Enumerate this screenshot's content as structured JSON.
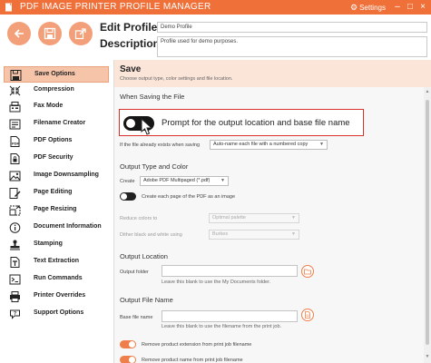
{
  "titlebar": {
    "title": "PDF IMAGE PRINTER PROFILE MANAGER",
    "settings_label": "Settings",
    "minimize": "–",
    "maximize": "□",
    "close": "×"
  },
  "header": {
    "title_line1": "Edit Profile -",
    "title_line2": "Description",
    "profile_name": "Demo Profile",
    "profile_description": "Profile used for demo purposes."
  },
  "sidebar": {
    "items": [
      {
        "label": "Save Options",
        "icon": "save-icon",
        "active": true
      },
      {
        "label": "Compression",
        "icon": "compress-icon"
      },
      {
        "label": "Fax Mode",
        "icon": "fax-icon"
      },
      {
        "label": "Filename Creator",
        "icon": "filename-icon"
      },
      {
        "label": "PDF Options",
        "icon": "pdf-options-icon"
      },
      {
        "label": "PDF Security",
        "icon": "lock-icon"
      },
      {
        "label": "Image Downsampling",
        "icon": "image-icon"
      },
      {
        "label": "Page Editing",
        "icon": "page-edit-icon"
      },
      {
        "label": "Page Resizing",
        "icon": "resize-icon"
      },
      {
        "label": "Document Information",
        "icon": "info-icon"
      },
      {
        "label": "Stamping",
        "icon": "stamp-icon"
      },
      {
        "label": "Text Extraction",
        "icon": "text-icon"
      },
      {
        "label": "Run Commands",
        "icon": "terminal-icon"
      },
      {
        "label": "Printer Overrides",
        "icon": "printer-icon"
      },
      {
        "label": "Support Options",
        "icon": "support-icon"
      }
    ]
  },
  "content": {
    "title": "Save",
    "subtitle": "Choose output type, color settings and file location.",
    "when_saving_heading": "When Saving the File",
    "prompt_label": "Prompt for the output location and base file name",
    "prompt_enabled": false,
    "if_exists_label": "If the file already exists when saving",
    "if_exists_value": "Auto-name each file with a numbered copy",
    "output_type_heading": "Output Type and Color",
    "create_label": "Create",
    "create_value": "Adobe PDF Multipaged (*.pdf)",
    "each_page_label": "Create each page of the PDF as an image",
    "each_page_enabled": false,
    "reduce_colors_label": "Reduce colors to",
    "reduce_colors_value": "Optimal palette",
    "dither_label": "Dither black and white using",
    "dither_value": "Burkes",
    "output_location_heading": "Output Location",
    "output_folder_label": "Output folder",
    "output_folder_value": "",
    "output_folder_hint": "Leave this blank to use the My Documents folder.",
    "output_filename_heading": "Output File Name",
    "base_file_name_label": "Base file name",
    "base_file_name_value": "",
    "base_file_name_hint": "Leave this blank to use the filename from the print job.",
    "remove_extension_label": "Remove product extension from print job filename",
    "remove_extension_enabled": true,
    "remove_product_label": "Remove product name from print job filename",
    "remove_product_enabled": true
  },
  "colors": {
    "accent": "#f0703a",
    "active_nav": "#f6c4a9",
    "callout_border": "#d9312b"
  }
}
